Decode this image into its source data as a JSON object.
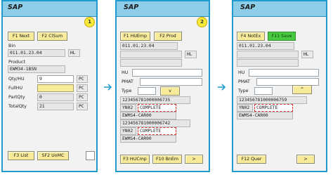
{
  "brand": "SAP",
  "colors": {
    "titlebar": "#8ecde8",
    "frame": "#1f9bcf",
    "button": "#f7eb9a",
    "button_active": "#49c93f",
    "badge": "#f7ea3a",
    "highlight_dash": "#e0332f"
  },
  "arrow_icon": "right-arrow-icon",
  "screen1": {
    "step": "1",
    "buttons": {
      "f1": "F1 Next",
      "f2": "F2 ClSum",
      "f3": "F3 List",
      "sf2": "SF2 UoMC"
    },
    "labels": {
      "bin": "Bin",
      "product": "Product",
      "qty_hu": "Qty/HU",
      "full_hu": "FullHU",
      "part_qty": "PartQty",
      "total_qty": "TotalQty"
    },
    "fields": {
      "bin": "011.01.23.04",
      "bin_unit": "HL",
      "product": "EWM34-1BSN",
      "qty_hu": "9",
      "qty_hu_unit": "PC",
      "full_hu": "",
      "full_hu_unit": "PC",
      "part_qty": "0",
      "part_qty_unit": "PC",
      "total_qty": "21",
      "total_qty_unit": "PC"
    }
  },
  "screen2": {
    "step": "2",
    "buttons": {
      "f1": "F1 HUEmp",
      "f2": "F2 Prod",
      "down": "v",
      "f3": "F3 HUCmp",
      "f10": "F10 BnEm",
      "next": ">"
    },
    "labels": {
      "hu": "HU",
      "pmat": "PMAT",
      "type": "Type"
    },
    "fields": {
      "bin": "011.01.23.04",
      "bin_unit": "HL",
      "hu1": "123456781000006735",
      "status1_code": "YN02",
      "status1": "COMPLETE",
      "product1": "EWMS4-CAR00",
      "hu2": "123456781000006742",
      "status2_code": "YN02",
      "status2": "COMPLETE",
      "product2": "EWMS4-CAR00"
    }
  },
  "screen3": {
    "buttons": {
      "f4": "F4 NotEx",
      "f11": "F11 Save",
      "up": "^",
      "f12": "F12 Quer",
      "next": ">"
    },
    "labels": {
      "hu": "HU",
      "pmat": "PMAT",
      "type": "Type"
    },
    "fields": {
      "bin": "011.01.23.04",
      "bin_unit": "HL",
      "hu1": "123456781000006759",
      "status1_code": "YN02",
      "status1": "COMPLETE",
      "product1": "EWMS4-CAR00"
    }
  }
}
